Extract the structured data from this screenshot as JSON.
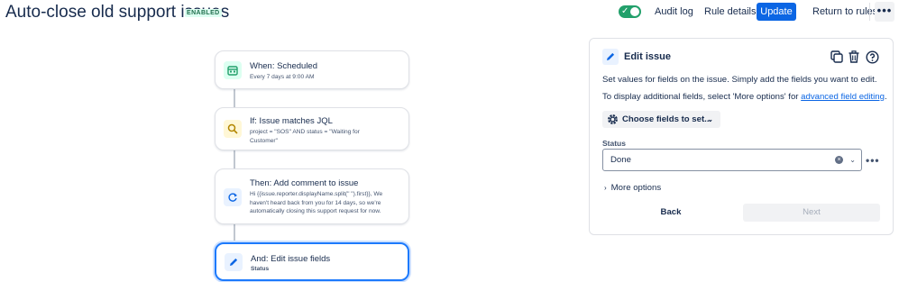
{
  "header": {
    "title": "Auto-close old support issues",
    "status_badge": "ENABLED",
    "audit_log": "Audit log",
    "rule_details": "Rule details",
    "update": "Update",
    "return_to_rules": "Return to rules",
    "more": "•••",
    "toggle_on": true
  },
  "flow": {
    "trigger": {
      "title": "When: Scheduled",
      "subtitle": "Every 7 days at 9:00 AM",
      "icon": "calendar-icon",
      "icon_color": "#22a06b"
    },
    "condition": {
      "title": "If: Issue matches JQL",
      "subtitle": "project = \"SOS\" AND status = \"Waiting for Customer\"",
      "icon": "search-icon",
      "icon_color": "#b38600"
    },
    "action1": {
      "title": "Then: Add comment to issue",
      "subtitle": "Hi {{issue.reporter.displayName.split(\" \").first}}, We haven't heard back from you for 14 days, so we're automatically closing this support request for now.",
      "icon": "refresh-arrow-icon",
      "icon_color": "#0c66e4"
    },
    "action2": {
      "title": "And: Edit issue fields",
      "subtitle": "Status",
      "icon": "pencil-icon",
      "icon_color": "#0c66e4"
    }
  },
  "panel": {
    "title": "Edit issue",
    "description": "Set values for fields on the issue. Simply add the fields you want to edit.",
    "additional_prefix": "To display additional fields, select 'More options' for ",
    "additional_link": "advanced field editing",
    "additional_suffix": ".",
    "choose_fields": "Choose fields to set...",
    "field_label": "Status",
    "field_value": "Done",
    "more_options": "More options",
    "back": "Back",
    "next": "Next"
  },
  "colors": {
    "accent": "#0c66e4",
    "enabled_green": "#22a06b",
    "selected_border": "#1d7afc"
  }
}
